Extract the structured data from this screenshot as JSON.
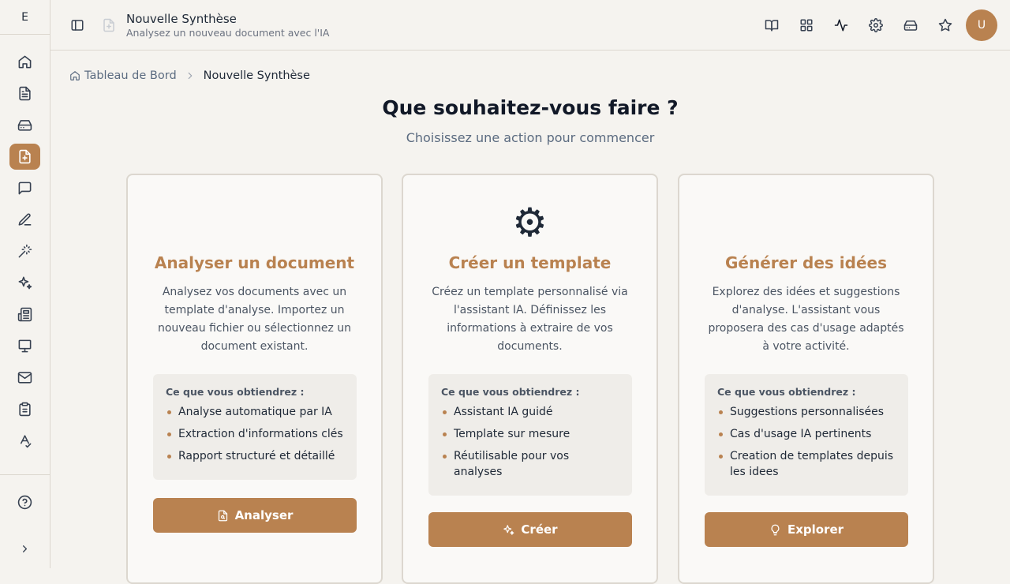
{
  "sidebar": {
    "logo": "E",
    "items": [
      {
        "icon": "home-icon",
        "active": false
      },
      {
        "icon": "document-icon",
        "active": false
      },
      {
        "icon": "inbox-icon",
        "active": false
      },
      {
        "icon": "new-document-icon",
        "active": true
      },
      {
        "icon": "chat-icon",
        "active": false
      },
      {
        "icon": "pen-icon",
        "active": false
      },
      {
        "icon": "magic-wand-icon",
        "active": false
      },
      {
        "icon": "sparkles-icon",
        "active": false
      },
      {
        "icon": "newspaper-icon",
        "active": false
      },
      {
        "icon": "presentation-icon",
        "active": false
      },
      {
        "icon": "mail-icon",
        "active": false
      },
      {
        "icon": "clipboard-icon",
        "active": false
      },
      {
        "icon": "spell-check-icon",
        "active": false
      }
    ],
    "help_icon": "help-circle-icon",
    "expand_icon": "chevron-right-icon"
  },
  "topbar": {
    "title": "Nouvelle Synthèse",
    "subtitle": "Analysez un nouveau document avec l'IA",
    "avatar_letter": "U",
    "actions": [
      "book-open-icon",
      "grid-icon",
      "activity-icon",
      "settings-icon",
      "inbox-icon",
      "star-icon"
    ]
  },
  "breadcrumb": {
    "home": "Tableau de Bord",
    "current": "Nouvelle Synthèse"
  },
  "main": {
    "heading": "Que souhaitez-vous faire ?",
    "subheading": "Choisissez une action pour commencer",
    "cards": [
      {
        "icon": "",
        "title": "Analyser un document",
        "description": "Analysez vos documents avec un template d'analyse. Importez un nouveau fichier ou sélectionnez un document existant.",
        "benefits_title": "Ce que vous obtiendrez :",
        "benefits": [
          "Analyse automatique par IA",
          "Extraction d'informations clés",
          "Rapport structuré et détaillé"
        ],
        "button": "Analyser"
      },
      {
        "icon": "⚙",
        "title": "Créer un template",
        "description": "Créez un template personnalisé via l'assistant IA. Définissez les informations à extraire de vos documents.",
        "benefits_title": "Ce que vous obtiendrez :",
        "benefits": [
          "Assistant IA guidé",
          "Template sur mesure",
          "Réutilisable pour vos analyses"
        ],
        "button": "Créer"
      },
      {
        "icon": "",
        "title": "Générer des idées",
        "description": "Explorez des idées et suggestions d'analyse. L'assistant vous proposera des cas d'usage adaptés à votre activité.",
        "benefits_title": "Ce que vous obtiendrez :",
        "benefits": [
          "Suggestions personnalisées",
          "Cas d'usage IA pertinents",
          "Creation de templates depuis les idees"
        ],
        "button": "Explorer"
      }
    ]
  },
  "colors": {
    "accent": "#b98250",
    "background": "#f5f3ef",
    "card": "#faf9f7"
  }
}
